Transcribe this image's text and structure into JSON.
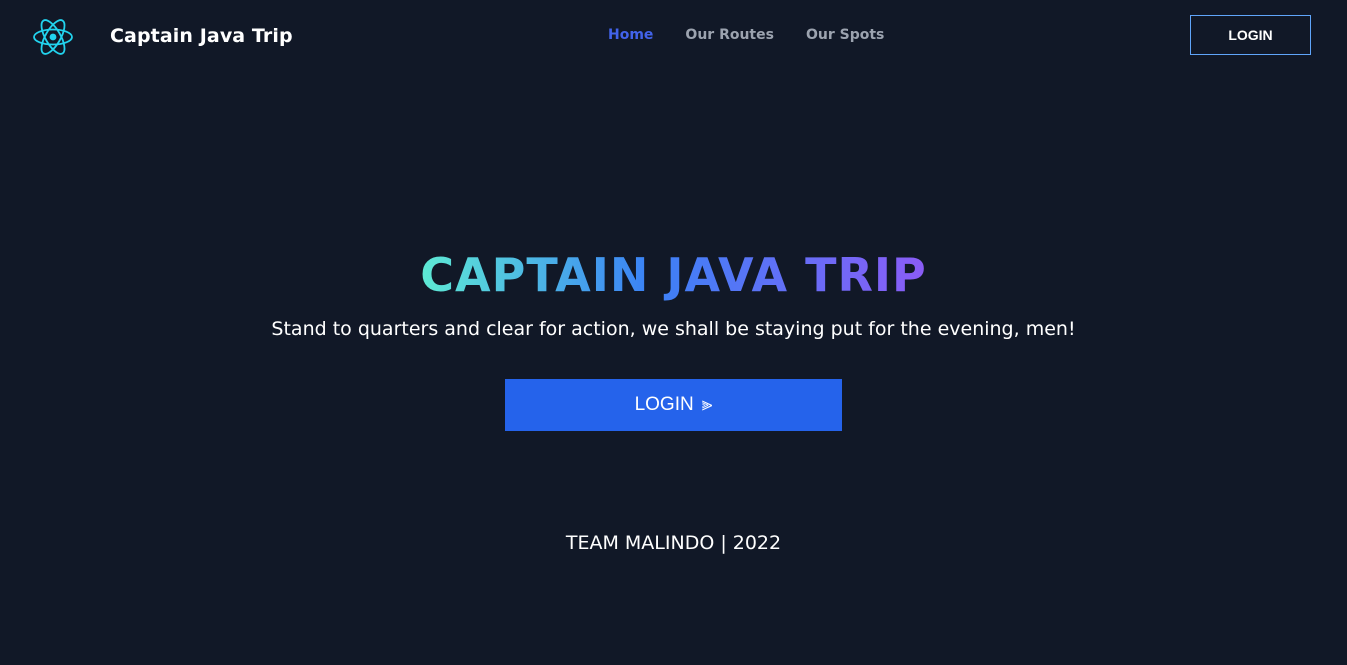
{
  "brand": {
    "name": "Captain Java Trip",
    "logo_icon": "react-atom-icon",
    "logo_color": "#22d3ee"
  },
  "nav": {
    "links": [
      {
        "label": "Home",
        "active": true
      },
      {
        "label": "Our Routes",
        "active": false
      },
      {
        "label": "Our Spots",
        "active": false
      }
    ],
    "login_label": "LOGIN"
  },
  "hero": {
    "title": "CAPTAIN JAVA TRIP",
    "subtitle": "Stand to quarters and clear for action, we shall be staying put for the evening, men!",
    "login_label": "LOGIN",
    "login_icon": "double-chevron-right-icon",
    "login_icon_glyph": "⫸"
  },
  "footer": {
    "text": "TEAM MALINDO | 2022"
  },
  "colors": {
    "background": "#111827",
    "accent": "#2563eb",
    "active_link": "#4263eb",
    "title_gradient_start": "#5eead4",
    "title_gradient_end": "#8b5cf6"
  }
}
